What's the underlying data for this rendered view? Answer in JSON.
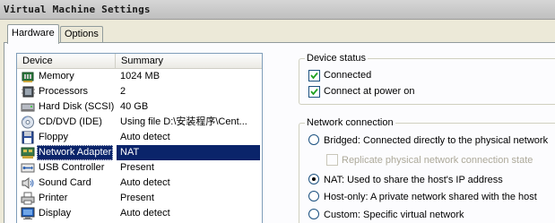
{
  "window": {
    "title": "Virtual Machine Settings"
  },
  "tabs": [
    {
      "label": "Hardware",
      "active": true
    },
    {
      "label": "Options",
      "active": false
    }
  ],
  "device_list": {
    "columns": [
      "Device",
      "Summary"
    ],
    "rows": [
      {
        "device": "Memory",
        "summary": "1024 MB",
        "icon": "memory-icon"
      },
      {
        "device": "Processors",
        "summary": "2",
        "icon": "processor-icon"
      },
      {
        "device": "Hard Disk (SCSI)",
        "summary": "40 GB",
        "icon": "hard-disk-icon"
      },
      {
        "device": "CD/DVD (IDE)",
        "summary": "Using file D:\\安装程序\\Cent...",
        "icon": "cd-dvd-icon"
      },
      {
        "device": "Floppy",
        "summary": "Auto detect",
        "icon": "floppy-icon"
      },
      {
        "device": "Network Adapter",
        "summary": "NAT",
        "icon": "network-adapter-icon",
        "selected": true
      },
      {
        "device": "USB Controller",
        "summary": "Present",
        "icon": "usb-icon"
      },
      {
        "device": "Sound Card",
        "summary": "Auto detect",
        "icon": "sound-card-icon"
      },
      {
        "device": "Printer",
        "summary": "Present",
        "icon": "printer-icon"
      },
      {
        "device": "Display",
        "summary": "Auto detect",
        "icon": "display-icon"
      }
    ]
  },
  "device_status": {
    "title": "Device status",
    "connected": {
      "label": "Connected",
      "checked": true
    },
    "connect_at_power_on": {
      "label": "Connect at power on",
      "checked": true
    }
  },
  "network_connection": {
    "title": "Network connection",
    "bridged": {
      "label": "Bridged: Connected directly to the physical network",
      "selected": false
    },
    "replicate": {
      "label": "Replicate physical network connection state",
      "checked": false,
      "enabled": false
    },
    "nat": {
      "label": "NAT: Used to share the host's IP address",
      "selected": true
    },
    "host_only": {
      "label": "Host-only: A private network shared with the host",
      "selected": false
    },
    "custom": {
      "label": "Custom: Specific virtual network",
      "selected": false
    }
  },
  "colors": {
    "selection": "#0a246a",
    "dialog_bg": "#ece9d8",
    "panel_bg": "#fcfcfe"
  }
}
